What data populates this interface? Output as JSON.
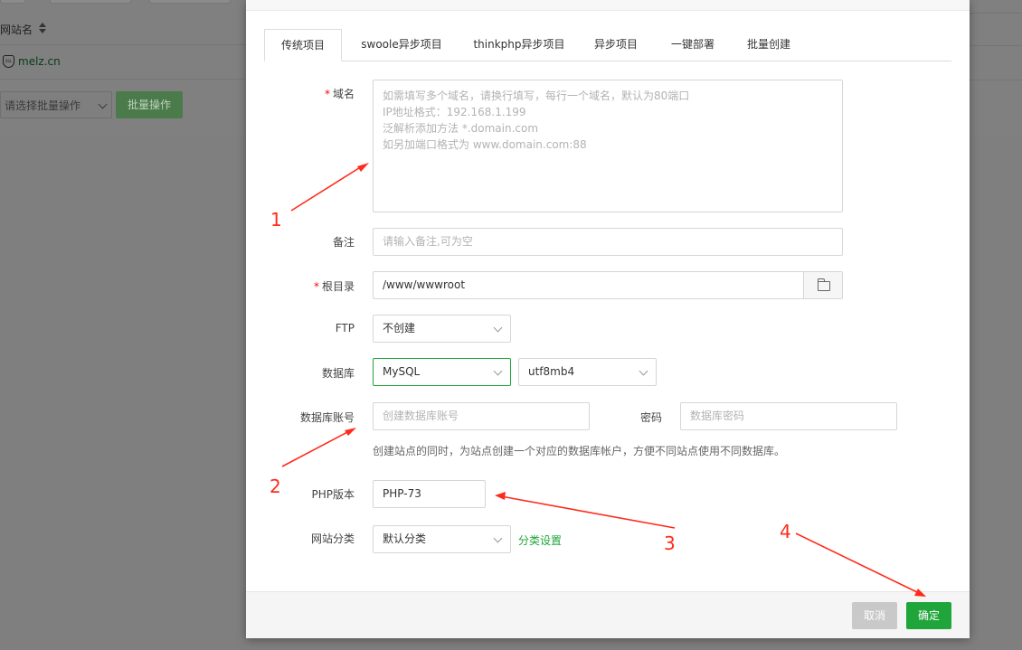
{
  "background": {
    "column_header": "网站名",
    "site_name": "melz.cn",
    "site_icon": "SSL",
    "batch_select_placeholder": "请选择批量操作",
    "batch_button": "批量操作"
  },
  "tabs": [
    {
      "label": "传统项目",
      "active": true
    },
    {
      "label": "swoole异步项目",
      "active": false
    },
    {
      "label": "thinkphp异步项目",
      "active": false
    },
    {
      "label": "异步项目",
      "active": false
    },
    {
      "label": "一键部署",
      "active": false
    },
    {
      "label": "批量创建",
      "active": false
    }
  ],
  "form": {
    "domain": {
      "required_mark": "*",
      "label": "域名",
      "placeholder": "如需填写多个域名，请换行填写，每行一个域名，默认为80端口\nIP地址格式：192.168.1.199\n泛解析添加方法 *.domain.com\n如另加端口格式为 www.domain.com:88"
    },
    "remark": {
      "label": "备注",
      "placeholder": "请输入备注,可为空"
    },
    "root_dir": {
      "required_mark": "*",
      "label": "根目录",
      "value": "/www/wwwroot"
    },
    "ftp": {
      "label": "FTP",
      "value": "不创建"
    },
    "database": {
      "label": "数据库",
      "type": "MySQL",
      "charset": "utf8mb4"
    },
    "db_account": {
      "label": "数据库账号",
      "placeholder": "创建数据库账号"
    },
    "db_password": {
      "label": "密码",
      "placeholder": "数据库密码"
    },
    "db_hint": "创建站点的同时，为站点创建一个对应的数据库帐户，方便不同站点使用不同数据库。",
    "php_version": {
      "label": "PHP版本",
      "value": "PHP-73"
    },
    "category": {
      "label": "网站分类",
      "value": "默认分类",
      "settings_link": "分类设置"
    }
  },
  "footer": {
    "cancel": "取消",
    "confirm": "确定"
  },
  "annotations": {
    "a1": "1",
    "a2": "2",
    "a3": "3",
    "a4": "4",
    "color": "#ff2a1a"
  },
  "colors": {
    "accent": "#20a53a",
    "required": "#ef0808"
  }
}
